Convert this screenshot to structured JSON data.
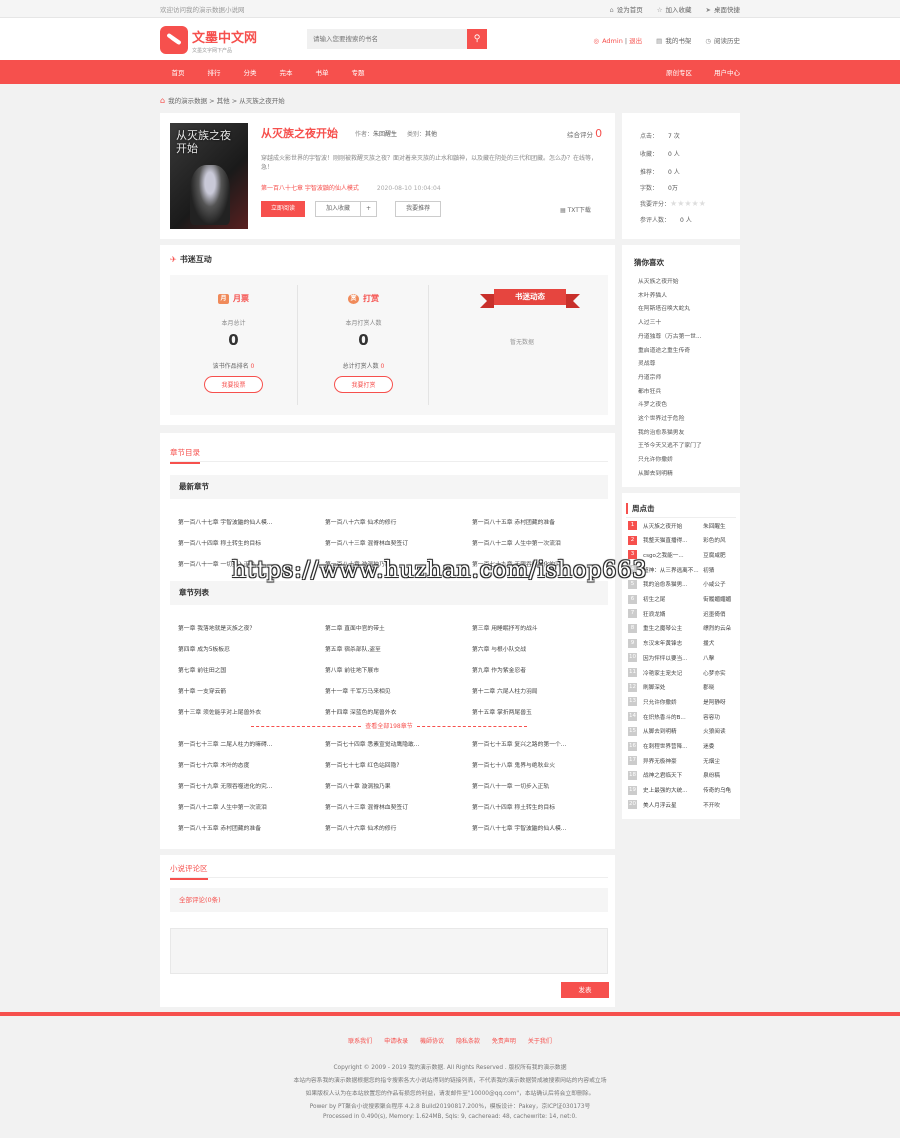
{
  "topbar": {
    "welcome": "欢迎访问我的演示数据小说网",
    "links": [
      "设为首页",
      "加入收藏",
      "桌面快捷"
    ]
  },
  "header": {
    "logo_title": "文墨中文网",
    "logo_sub": "文墨文字网下产品",
    "search_placeholder": "请输入您要搜索的书名",
    "user": "Admin",
    "user_sep": "|",
    "user_exit": "退出",
    "shelf": "我的书架",
    "history": "阅读历史"
  },
  "nav": {
    "items": [
      "首页",
      "排行",
      "分类",
      "完本",
      "书单",
      "专题"
    ],
    "right": [
      "原创专区",
      "用户中心"
    ]
  },
  "breadcrumb": "我的演示数据 > 其他 > 从灭族之夜开始",
  "book": {
    "cover_text": "从灭族之夜开始",
    "title": "从灭族之夜开始",
    "author_label": "作者：",
    "author": "朱回醒生",
    "category_label": "类别：",
    "category": "其他",
    "score_label": "综合评分",
    "score": "0",
    "desc": "穿越成火影世界的宇智波！刚刚被救醒灭族之夜？面对着来灭族的止水和鼬神，以及藏在阴处的三代和团藏。怎么办？在线等，急！",
    "latest_chapter": "第一百八十七章 宇智波鼬的仙人模式",
    "latest_time": "2020-08-10 10:04:04",
    "btn_read": "立即阅读",
    "btn_fav": "加入收藏",
    "btn_plus": "+",
    "btn_rec": "我要推荐",
    "txt_download": "TXT下载"
  },
  "stats": {
    "rows": [
      {
        "label": "点击：",
        "value": "7 次"
      },
      {
        "label": "收藏：",
        "value": "0 人"
      },
      {
        "label": "推荐：",
        "value": "0 人"
      },
      {
        "label": "字数：",
        "value": "0万"
      }
    ],
    "rating_label": "我要评分：",
    "rating_count_label": "参评人数：",
    "rating_count": "0 人",
    "rating_stars": 5
  },
  "interaction": {
    "title": "书迷互动",
    "monthly": {
      "title": "月票",
      "icon": "月",
      "label": "本月总计",
      "value": "0",
      "rank_label": "该书作品排名",
      "rank": "0",
      "btn": "我要投票"
    },
    "reward": {
      "title": "打赏",
      "icon": "赏",
      "label": "本月打赏人数",
      "value": "0",
      "total_label": "总计打赏人数",
      "total": "0",
      "btn": "我要打赏"
    },
    "dynamics": {
      "title": "书迷动态",
      "empty": "暂无数据"
    }
  },
  "chapters": {
    "tab": "章节目录",
    "latest_title": "最新章节",
    "latest": [
      "第一百八十七章 宇智波鼬的仙人模...",
      "第一百八十六章 仙术的修行",
      "第一百八十五章 赤村团藏的准备",
      "第一百八十四章 称土转生的目标",
      "第一百八十三章 混脊林血契签订",
      "第一百八十二章 人生中第一次流泪",
      "第一百八十一章 一切步入正轨",
      "第一百八十章 漩涡独乃果",
      "第一百七十九章 无限吞噬进化的究..."
    ],
    "list_title": "章节列表",
    "list_a": [
      "第一章 我落地就是灭族之夜？",
      "第二章 直面中官的带土",
      "第三章 用睡眠抒写的战斗",
      "第四章 成为5板板忍",
      "第五章 宿杀部队,盗至",
      "第六章 与根小队交战",
      "第七章 前往田之国",
      "第八章 前往地下展市",
      "第九章 作为紫金忍者",
      "第十章 一支穿云箭",
      "第十一章 千军万马来相见",
      "第十二章 六尾人柱力羽局",
      "第十三章 须佐能乎对上尾兽外衣",
      "第十四章 深蓝色的尾兽外衣",
      "第十五章 掌折两尾兽玉"
    ],
    "more": "查看全部198章节",
    "list_b": [
      "第一百七十三章 二尾人柱力的嘛碍...",
      "第一百七十四章 悉素宣觉动鹰隐敢...",
      "第一百七十五章 复兴之路的第一个...",
      "第一百七十六章 木叶的态度",
      "第一百七十七章 红色站回隐?",
      "第一百七十八章 鬼界与绝秋业火",
      "第一百七十九章 无限吞噬进化的究...",
      "第一百八十章 漩涡独乃果",
      "第一百八十一章 一切步入正轨",
      "第一百八十二章 人生中第一次流泪",
      "第一百八十三章 混脊林血契签订",
      "第一百八十四章 称土转生的目标",
      "第一百八十五章 赤村团藏的准备",
      "第一百八十六章 仙术的修行",
      "第一百八十七章 宇智波鼬的仙人模..."
    ]
  },
  "comments": {
    "tab": "小说评论区",
    "all": "全部评论(0条)",
    "send": "发表"
  },
  "likes": {
    "title": "猜你喜欢",
    "items": [
      "从灭族之夜开始",
      "木叶养猫人",
      "在阿斯塔召唤大蛇丸",
      "人过三十",
      "丹道独尊（万古第一世...",
      "重启道途之重生传奇",
      "灵战尊",
      "丹道宗师",
      "都市狂兵",
      "斗罗之夜色",
      "这个世界过于危险",
      "我的治愈系猫男友",
      "王爷今天又逃不了家门了",
      "只允许你撒娇",
      "从脚去到明精"
    ]
  },
  "hot": {
    "title": "周点击",
    "items": [
      {
        "rank": "1",
        "book": "从灭族之夜开始",
        "author": "朱回醒生"
      },
      {
        "rank": "2",
        "book": "我整天猫直播得...",
        "author": "彩色的风"
      },
      {
        "rank": "3",
        "book": "csgo之我能一...",
        "author": "豆腐咸肥"
      },
      {
        "rank": "4",
        "book": "超神：从三界逃离不...",
        "author": "初猜"
      },
      {
        "rank": "5",
        "book": "我的治愈系猫男...",
        "author": "小咸公子"
      },
      {
        "rank": "6",
        "book": "初生之尾",
        "author": "街履媚媚媚"
      },
      {
        "rank": "7",
        "book": "狂浪龙婿",
        "author": "迟墨倚俏"
      },
      {
        "rank": "8",
        "book": "重生之魔琴公主",
        "author": "缥烈的云朵"
      },
      {
        "rank": "9",
        "book": "东汉末年黄锋志",
        "author": "援犬"
      },
      {
        "rank": "10",
        "book": "因为怦怦以要当...",
        "author": "八擊"
      },
      {
        "rank": "11",
        "book": "冷艳家主宠夫记",
        "author": "心梦亦实"
      },
      {
        "rank": "12",
        "book": "刷脚深处",
        "author": "郡晓"
      },
      {
        "rank": "13",
        "book": "只允许你撒娇",
        "author": "是阿静呀"
      },
      {
        "rank": "14",
        "book": "在炽热香斗的B...",
        "author": "容容功"
      },
      {
        "rank": "15",
        "book": "从脚去到明精",
        "author": "火狼阅读"
      },
      {
        "rank": "16",
        "book": "在刺程世界营降...",
        "author": "迷委"
      },
      {
        "rank": "17",
        "book": "异界无极神豪",
        "author": "无烟尘"
      },
      {
        "rank": "18",
        "book": "战神之君临天下",
        "author": "泉纷稿"
      },
      {
        "rank": "19",
        "book": "史上最强的大统...",
        "author": "传奇的乌龟"
      },
      {
        "rank": "20",
        "book": "美人月浮云星",
        "author": "不开吹"
      }
    ]
  },
  "footer": {
    "links": [
      "联系我们",
      "申请收录",
      "機師协议",
      "隐私条款",
      "免责声明",
      "关于我们"
    ],
    "copyright": "Copyright © 2009 - 2019 我的演示数据. All Rights Reserved . 版权所有我的演示数据",
    "line2": "本站内容系我的演示数据根据您的指令搜索各大小说站得到的链接列表，不代表我的演示数据赞成被搜索网站的内容或立场",
    "line3": "如果版权人认为在本站放置您的作品有损您的利益，请发邮件至\"10000@qq.com\"，本站确认后将会立即删除。",
    "line4": "Power by PT聚合小说搜索聚合程序 4.2.8 Build20190817.200%，模板设计：Pakey，京ICP证030173号",
    "line5": "Processed in 0.490(s), Memory: 1.624MB, Sqls: 9, cacheread: 48, cachewrite: 14, net:0."
  },
  "watermark": "https://www.huzhan.com/ishop663"
}
